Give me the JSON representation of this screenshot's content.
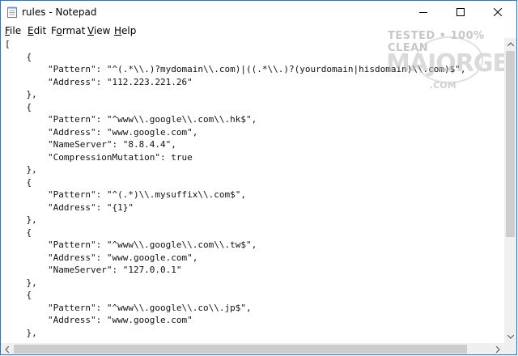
{
  "window": {
    "title": "rules - Notepad"
  },
  "menu": [
    {
      "prefix": "",
      "accel": "F",
      "rest": "ile"
    },
    {
      "prefix": "",
      "accel": "E",
      "rest": "dit"
    },
    {
      "prefix": "F",
      "accel": "o",
      "rest": "rmat"
    },
    {
      "prefix": "",
      "accel": "V",
      "rest": "iew"
    },
    {
      "prefix": "",
      "accel": "H",
      "rest": "elp"
    }
  ],
  "content": "[\n    {\n        \"Pattern\": \"^(.*\\\\.)?mydomain\\\\.com)|((.*\\\\.)?(yourdomain|hisdomain)\\\\.com)$\",\n        \"Address\": \"112.223.221.26\"\n    },\n    {\n        \"Pattern\": \"^www\\\\.google\\\\.com\\\\.hk$\",\n        \"Address\": \"www.google.com\",\n        \"NameServer\": \"8.8.4.4\",\n        \"CompressionMutation\": true\n    },\n    {\n        \"Pattern\": \"^(.*)\\\\.mysuffix\\\\.com$\",\n        \"Address\": \"{1}\"\n    },\n    {\n        \"Pattern\": \"^www\\\\.google\\\\.com\\\\.tw$\",\n        \"Address\": \"www.google.com\",\n        \"NameServer\": \"127.0.0.1\"\n    },\n    {\n        \"Pattern\": \"^www\\\\.google\\\\.co\\\\.jp$\",\n        \"Address\": \"www.google.com\"\n    },",
  "watermark": {
    "line1": "TESTED • 100% CLEAN",
    "line2": "MAJORGEEKS",
    "line3": ".COM"
  }
}
